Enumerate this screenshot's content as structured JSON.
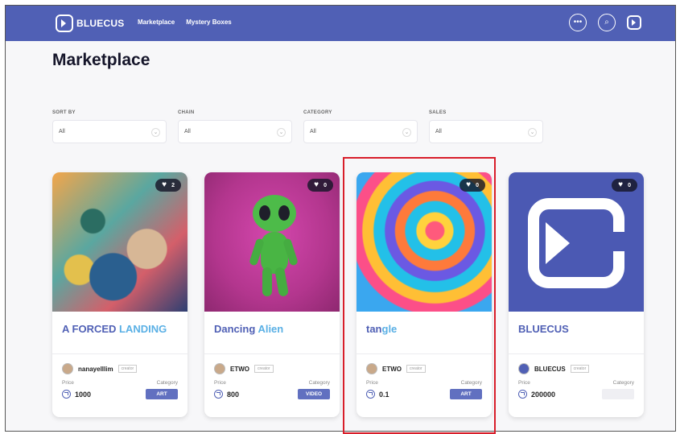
{
  "header": {
    "logo_text": "BLUECUS",
    "nav": [
      "Marketplace",
      "Mystery Boxes"
    ],
    "icons": [
      "more-icon",
      "search-icon",
      "bluecus-icon"
    ]
  },
  "page_title": "Marketplace",
  "filters": [
    {
      "label": "SORT BY",
      "value": "All"
    },
    {
      "label": "CHAIN",
      "value": "All"
    },
    {
      "label": "CATEGORY",
      "value": "All"
    },
    {
      "label": "SALES",
      "value": "All"
    }
  ],
  "cards": [
    {
      "name_main": "A FORCED",
      "name_accent": "LANDING",
      "likes": "2",
      "creator": "nanayelllim",
      "creator_tag": "creator",
      "price_label": "Price",
      "price": "1000",
      "category_label": "Category",
      "category": "ART"
    },
    {
      "name_main": "Dancing",
      "name_accent": "Alien",
      "likes": "0",
      "creator": "ETWO",
      "creator_tag": "creator",
      "price_label": "Price",
      "price": "800",
      "category_label": "Category",
      "category": "VIDEO"
    },
    {
      "name_main": "tan",
      "name_accent": "gle",
      "likes": "0",
      "creator": "ETWO",
      "creator_tag": "creator",
      "price_label": "Price",
      "price": "0.1",
      "category_label": "Category",
      "category": "ART"
    },
    {
      "name_main": "BLUE",
      "name_accent": "CUS",
      "likes": "0",
      "creator": "BLUECUS",
      "creator_tag": "creator",
      "price_label": "Price",
      "price": "200000",
      "category_label": "Category",
      "category": ""
    }
  ],
  "colors": {
    "brand": "#5060b5",
    "accent": "#5ab0e5",
    "highlight": "#d81e2a"
  }
}
